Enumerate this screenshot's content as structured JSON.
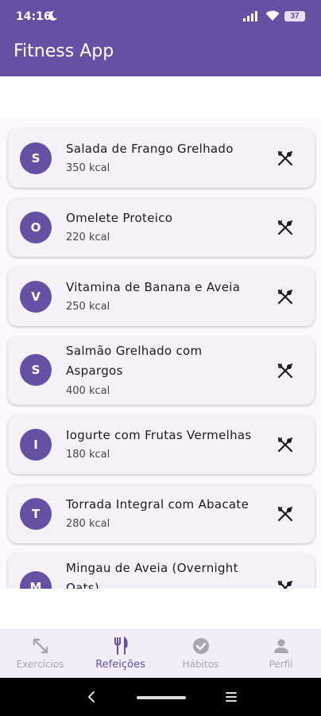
{
  "status_bar": {
    "time": "14:16",
    "battery": "37"
  },
  "app_bar": {
    "title": "Fitness App"
  },
  "meals": [
    {
      "initial": "S",
      "name": "Salada de Frango Grelhado",
      "kcal": "350 kcal"
    },
    {
      "initial": "O",
      "name": "Omelete Proteico",
      "kcal": "220 kcal"
    },
    {
      "initial": "V",
      "name": "Vitamina de Banana e Aveia",
      "kcal": "250 kcal"
    },
    {
      "initial": "S",
      "name": "Salmão Grelhado com",
      "name_line2": "Aspargos",
      "kcal": "400 kcal"
    },
    {
      "initial": "I",
      "name": "Iogurte com Frutas Vermelhas",
      "kcal": "180 kcal"
    },
    {
      "initial": "T",
      "name": "Torrada Integral com Abacate",
      "kcal": "280 kcal"
    },
    {
      "initial": "M",
      "name": "Mingau de Aveia (Overnight",
      "name_line2": "Oats)"
    }
  ],
  "meal_action_icon": "utensils-crossed-icon",
  "bottom_nav": [
    {
      "label": "Exercícios",
      "icon": "arrows-diagonal-icon",
      "active": false
    },
    {
      "label": "Refeições",
      "icon": "fork-knife-icon",
      "active": true
    },
    {
      "label": "Hábitos",
      "icon": "check-circle-icon",
      "active": false
    },
    {
      "label": "Perfil",
      "icon": "person-icon",
      "active": false
    }
  ],
  "colors": {
    "primary": "#6750a4",
    "card": "#f6f1f8",
    "nav_bg": "#f3edf7",
    "inactive": "#a9a6ae"
  }
}
